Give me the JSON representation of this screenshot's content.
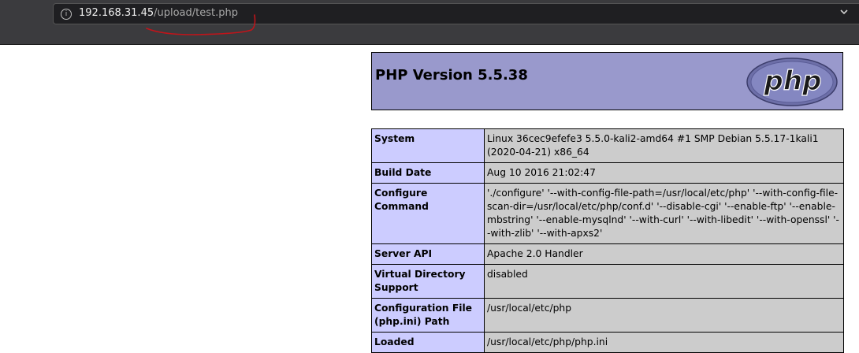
{
  "browser": {
    "url_host": "192.168.31.45",
    "url_path": "/upload/test.php"
  },
  "icons": {
    "info": "info-icon",
    "dropdown": "chevron-down-icon",
    "logo": "php-logo"
  },
  "phpinfo": {
    "title": "PHP Version 5.5.38",
    "logo_text": "php",
    "rows": [
      {
        "key": "System",
        "value": "Linux 36cec9efefe3 5.5.0-kali2-amd64 #1 SMP Debian 5.5.17-1kali1 (2020-04-21) x86_64"
      },
      {
        "key": "Build Date",
        "value": "Aug 10 2016 21:02:47"
      },
      {
        "key": "Configure Command",
        "value": "'./configure' '--with-config-file-path=/usr/local/etc/php' '--with-config-file-scan-dir=/usr/local/etc/php/conf.d' '--disable-cgi' '--enable-ftp' '--enable-mbstring' '--enable-mysqlnd' '--with-curl' '--with-libedit' '--with-openssl' '--with-zlib' '--with-apxs2'"
      },
      {
        "key": "Server API",
        "value": "Apache 2.0 Handler"
      },
      {
        "key": "Virtual Directory Support",
        "value": "disabled"
      },
      {
        "key": "Configuration File (php.ini) Path",
        "value": "/usr/local/etc/php"
      },
      {
        "key": "Loaded",
        "value": "/usr/local/etc/php/php.ini"
      }
    ]
  },
  "colors": {
    "header_bg": "#9999cc",
    "key_bg": "#ccccff",
    "value_bg": "#cccccc",
    "annotation": "#c0141a"
  }
}
